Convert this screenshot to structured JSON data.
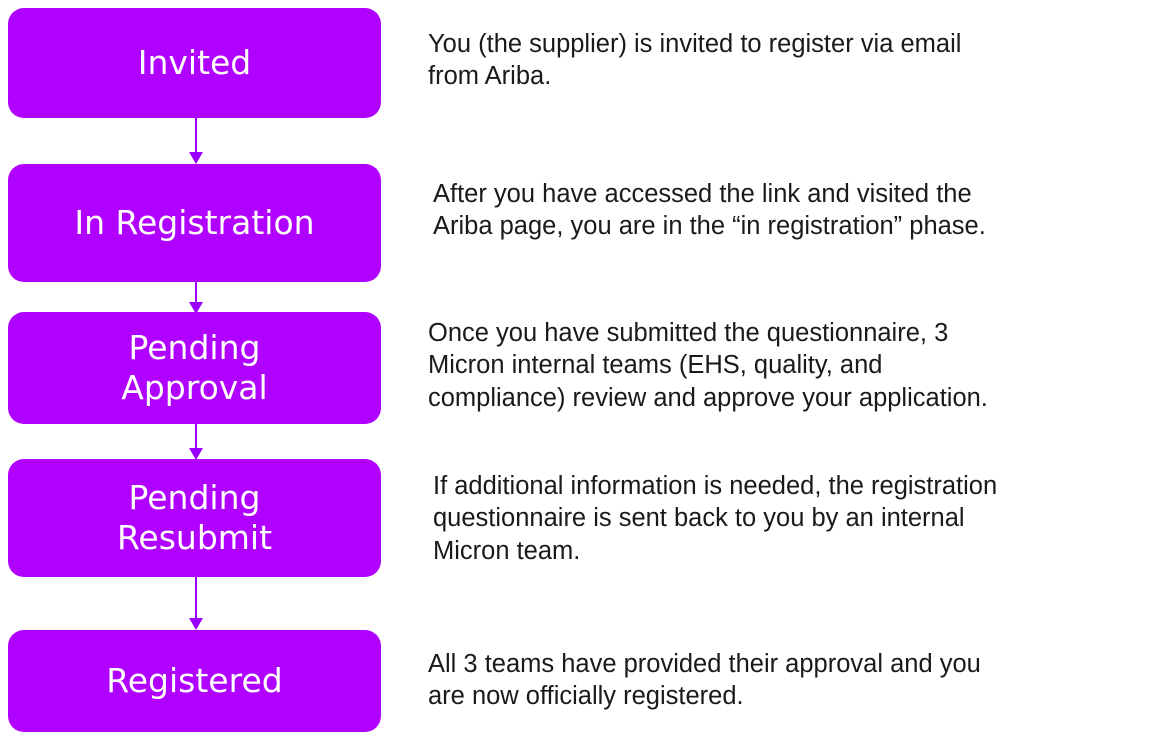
{
  "stages": [
    {
      "label": "Invited",
      "description": "You (the supplier) is invited to register via email\nfrom Ariba."
    },
    {
      "label": "In Registration",
      "description": "After you have accessed the link and visited the\nAriba page, you are in the “in registration” phase."
    },
    {
      "label": "Pending\nApproval",
      "description": "Once you have submitted the questionnaire, 3\nMicron internal teams (EHS, quality, and\ncompliance) review and approve your application."
    },
    {
      "label": "Pending\nResubmit",
      "description": "If additional information is needed, the registration\nquestionnaire is sent back to you by an internal\nMicron team."
    },
    {
      "label": "Registered",
      "description": "All 3 teams have provided their approval and you\nare now officially registered."
    }
  ],
  "colors": {
    "stage_fill": "#b000ff",
    "connector": "#9a00ff",
    "text": "#1a1a1a"
  }
}
